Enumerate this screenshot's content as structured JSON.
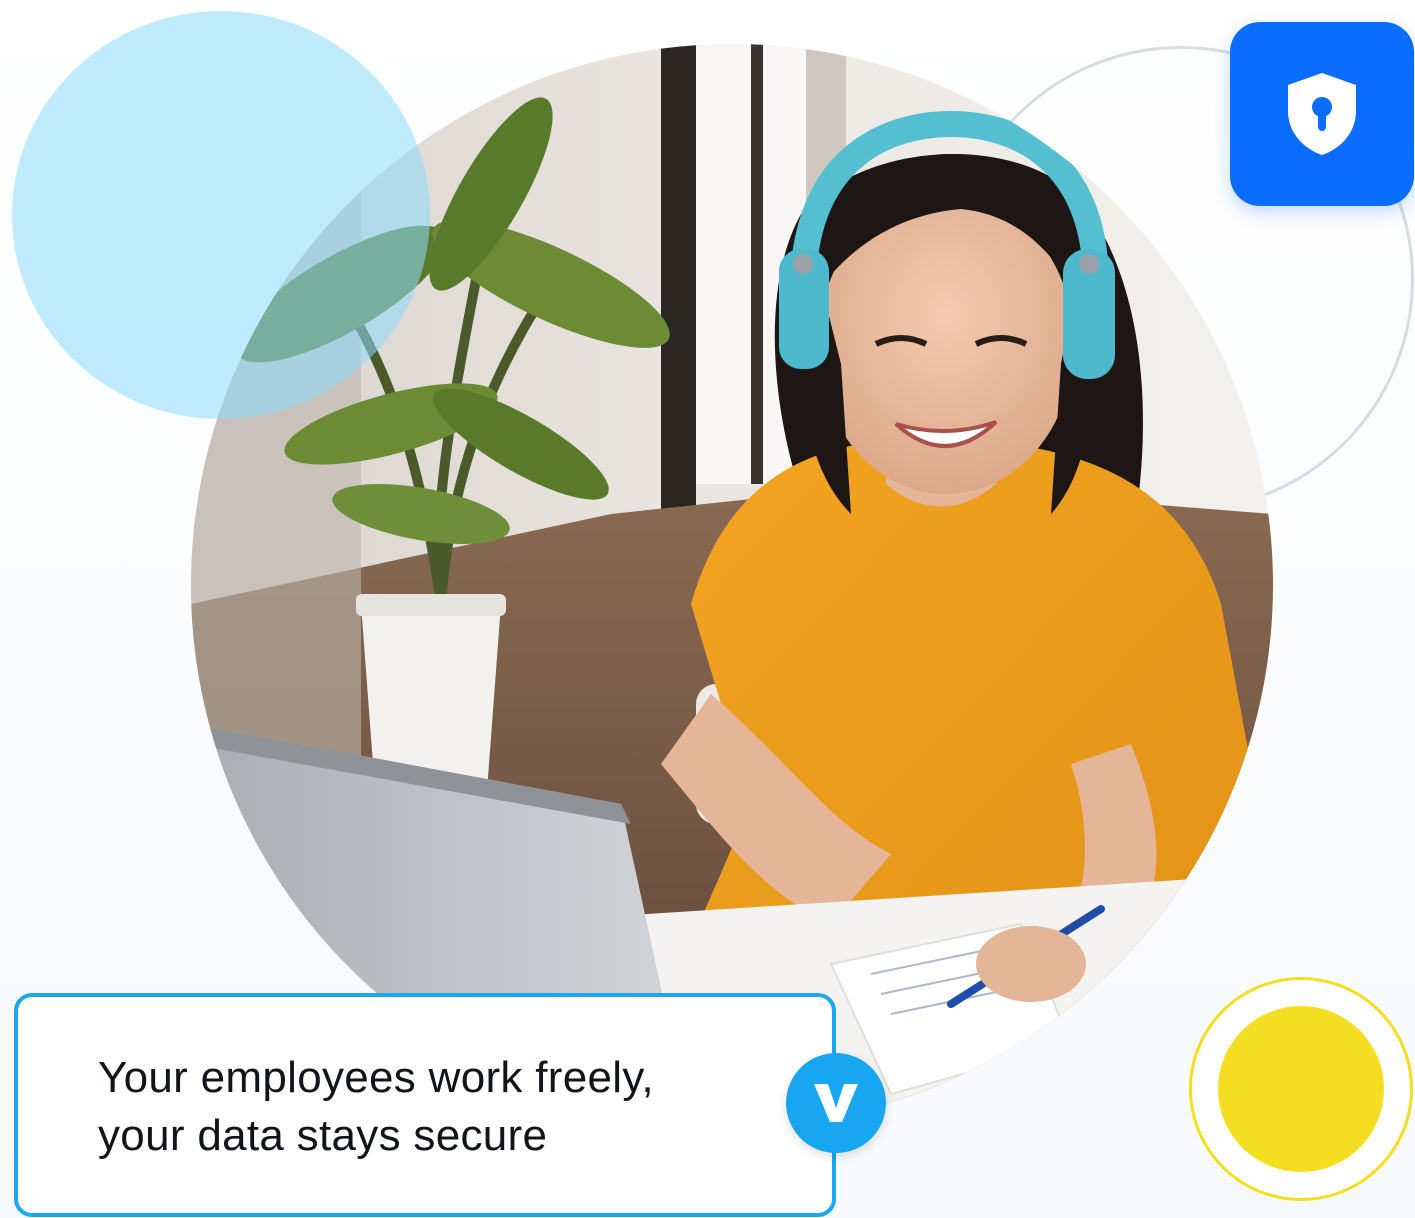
{
  "caption": {
    "line1": "Your employees work freely,",
    "line2": "your data stays secure"
  },
  "badges": {
    "shield": {
      "icon": "shield-keyhole-icon",
      "color": "#0a6dff"
    },
    "brand": {
      "icon": "v-logo-icon",
      "color": "#18a6f0"
    }
  },
  "photo": {
    "subject": "woman-with-headphones-at-laptop"
  },
  "colors": {
    "card_border": "#1aa8f2",
    "accent_yellow": "#f5de22",
    "blob_blue": "#8ddafb"
  }
}
